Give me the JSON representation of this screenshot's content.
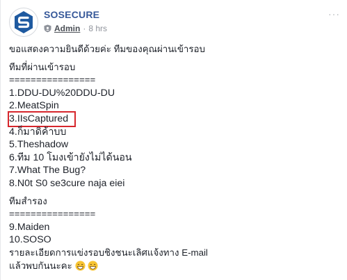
{
  "post": {
    "page_name": "SOSECURE",
    "author_role": "Admin",
    "timestamp": "8 hrs",
    "more_label": "···"
  },
  "content": {
    "intro": "ขอแสดงความยินดีด้วยค่ะ ทีมของคุณผ่านเข้ารอบ",
    "passed_heading": "ทีมที่ผ่านเข้ารอบ",
    "separator": "================",
    "passed_teams": [
      "1.DDU-DU%20DDU-DU",
      "2.MeatSpin",
      "3.IIsCaptured",
      "4.ก็มาดิค้าบบ",
      "5.Theshadow",
      "6.ทีม 10 โมงเข้ายังไม่ได้นอน",
      "7.What The Bug?",
      "8.N0t S0 se3cure naja eiei"
    ],
    "reserve_heading": "ทีมสำรอง",
    "reserve_separator": "================",
    "reserve_teams": [
      "9.Maiden",
      "10.SOSO"
    ],
    "details": "รายละเอียดการแข่งรอบชิงชนะเลิศแจ้งทาง E-mail",
    "closing": "แล้วพบกันนะคะ"
  },
  "colors": {
    "page_name": "#365899",
    "highlight_box": "#d6262c",
    "meta": "#90949c"
  }
}
